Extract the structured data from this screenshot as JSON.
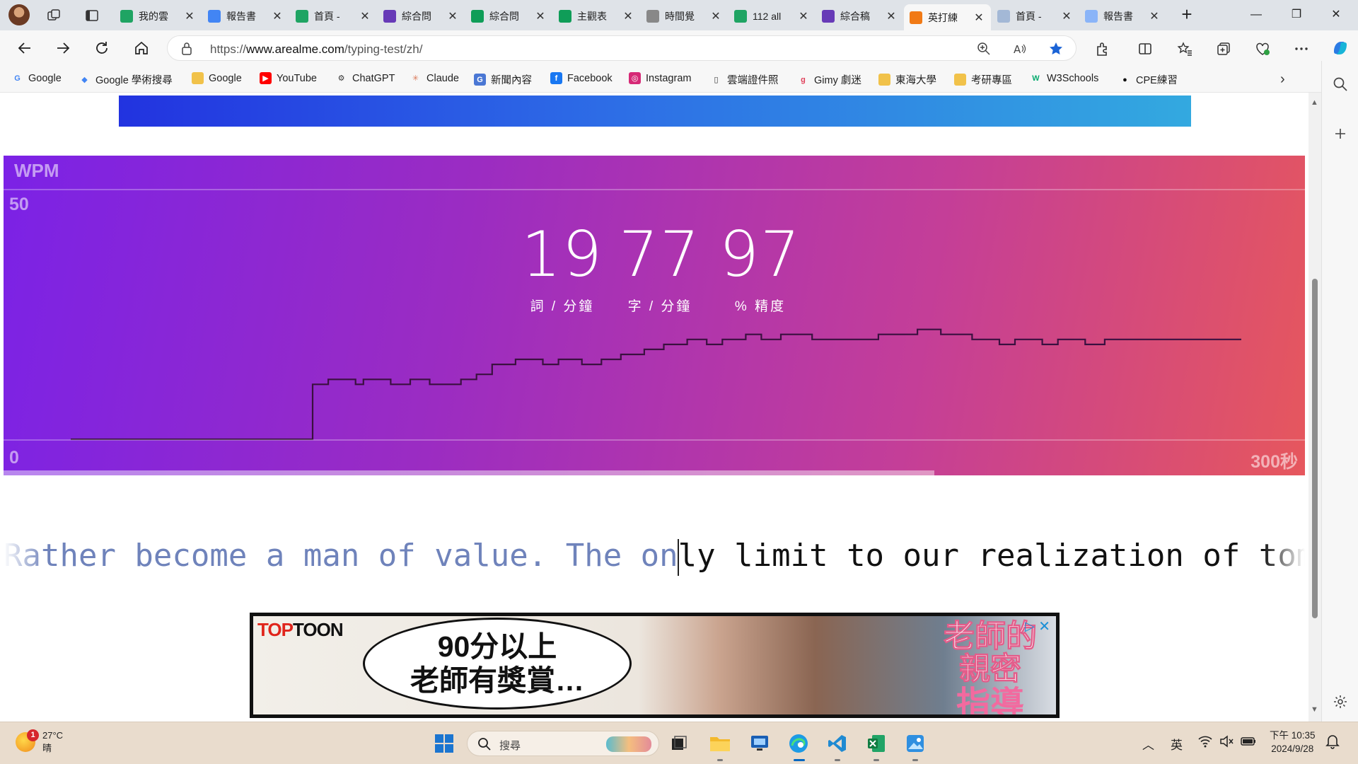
{
  "browser": {
    "tabs": [
      {
        "title": "我的雲",
        "icon": "google-drive-icon",
        "color": "#1fa463"
      },
      {
        "title": "報告書",
        "icon": "google-docs-icon",
        "color": "#4285f4"
      },
      {
        "title": "首頁 - ",
        "icon": "google-drive-icon",
        "color": "#1fa463"
      },
      {
        "title": "綜合問",
        "icon": "google-forms-icon",
        "color": "#673ab7"
      },
      {
        "title": "綜合問",
        "icon": "google-sheets-icon",
        "color": "#0f9d58"
      },
      {
        "title": "主觀表",
        "icon": "google-sheets-icon",
        "color": "#0f9d58"
      },
      {
        "title": "時間覺",
        "icon": "chatgpt-icon",
        "color": "#888888"
      },
      {
        "title": "112 all",
        "icon": "google-slides-icon",
        "color": "#1fa463"
      },
      {
        "title": "綜合稿",
        "icon": "google-forms-icon",
        "color": "#673ab7"
      },
      {
        "title": "英打練",
        "icon": "fox-icon",
        "color": "#f17a16"
      },
      {
        "title": "首頁 - ",
        "icon": "google-drive-icon",
        "color": "#a3b8d6"
      },
      {
        "title": "報告書",
        "icon": "google-docs-icon",
        "color": "#8ab4f8"
      }
    ],
    "active_tab_index": 9,
    "url_prefix": "https://",
    "url_domain": "www.arealme.com",
    "url_path": "/typing-test/zh/",
    "bookmarks": [
      {
        "label": "Google",
        "icon": "google-icon"
      },
      {
        "label": "Google 學術搜尋",
        "icon": "scholar-icon"
      },
      {
        "label": "Google",
        "icon": "folder-icon"
      },
      {
        "label": "YouTube",
        "icon": "youtube-icon"
      },
      {
        "label": "ChatGPT",
        "icon": "chatgpt-icon"
      },
      {
        "label": "Claude",
        "icon": "claude-icon"
      },
      {
        "label": "新聞內容",
        "icon": "news-icon"
      },
      {
        "label": "Facebook",
        "icon": "facebook-icon"
      },
      {
        "label": "Instagram",
        "icon": "instagram-icon"
      },
      {
        "label": "雲端證件照",
        "icon": "page-icon"
      },
      {
        "label": "Gimy 劇迷",
        "icon": "gimy-icon"
      },
      {
        "label": "東海大學",
        "icon": "folder-icon"
      },
      {
        "label": "考研專區",
        "icon": "folder-icon"
      },
      {
        "label": "W3Schools",
        "icon": "w3schools-icon"
      },
      {
        "label": "CPE練習",
        "icon": "github-icon"
      }
    ]
  },
  "result": {
    "wpm_label": "WPM",
    "y_max_label": "50",
    "y_min_label": "0",
    "x_end_label": "300秒",
    "wpm": "19",
    "wpm_unit": "詞 / 分鐘",
    "cpm": "77",
    "cpm_unit": "字 / 分鐘",
    "accuracy": "97",
    "accuracy_unit": "% 精度",
    "progress_fraction": 0.715
  },
  "chart_data": {
    "type": "line",
    "title": "",
    "xlabel": "",
    "ylabel": "WPM",
    "x_range": [
      0,
      300
    ],
    "ylim": [
      0,
      50
    ],
    "x_end_label": "300秒",
    "series": [
      {
        "points": [
          [
            0,
            0
          ],
          [
            20,
            0
          ],
          [
            40,
            0
          ],
          [
            61,
            0
          ],
          [
            62,
            11
          ],
          [
            64,
            11
          ],
          [
            66,
            12
          ],
          [
            71,
            12
          ],
          [
            73,
            11
          ],
          [
            75,
            12
          ],
          [
            76,
            12
          ],
          [
            80,
            12
          ],
          [
            82,
            11
          ],
          [
            85,
            11
          ],
          [
            87,
            12
          ],
          [
            90,
            12
          ],
          [
            92,
            11
          ],
          [
            98,
            11
          ],
          [
            100,
            12
          ],
          [
            102,
            12
          ],
          [
            104,
            13
          ],
          [
            106,
            13
          ],
          [
            108,
            15
          ],
          [
            112,
            15
          ],
          [
            114,
            16
          ],
          [
            119,
            16
          ],
          [
            121,
            15
          ],
          [
            123,
            15
          ],
          [
            125,
            16
          ],
          [
            129,
            16
          ],
          [
            131,
            15
          ],
          [
            134,
            15
          ],
          [
            136,
            16
          ],
          [
            139,
            16
          ],
          [
            141,
            17
          ],
          [
            145,
            17
          ],
          [
            147,
            18
          ],
          [
            150,
            18
          ],
          [
            152,
            19
          ],
          [
            156,
            19
          ],
          [
            158,
            20
          ],
          [
            161,
            20
          ],
          [
            163,
            19
          ],
          [
            165,
            19
          ],
          [
            167,
            20
          ],
          [
            171,
            20
          ],
          [
            173,
            21
          ],
          [
            175,
            21
          ],
          [
            177,
            20
          ],
          [
            180,
            20
          ],
          [
            182,
            21
          ],
          [
            188,
            21
          ],
          [
            190,
            20
          ],
          [
            205,
            20
          ],
          [
            207,
            21
          ],
          [
            215,
            21
          ],
          [
            217,
            22
          ],
          [
            221,
            22
          ],
          [
            223,
            21
          ],
          [
            229,
            21
          ],
          [
            231,
            20
          ],
          [
            236,
            20
          ],
          [
            238,
            19
          ],
          [
            240,
            19
          ],
          [
            242,
            20
          ],
          [
            247,
            20
          ],
          [
            249,
            19
          ],
          [
            251,
            19
          ],
          [
            253,
            20
          ],
          [
            258,
            20
          ],
          [
            260,
            19
          ],
          [
            263,
            19
          ],
          [
            265,
            20
          ],
          [
            300,
            20
          ]
        ]
      }
    ],
    "grid": true
  },
  "typing": {
    "typed": "Rather become a man of value. The on",
    "remaining": "ly limit to our realization of tomo"
  },
  "ad": {
    "brand_red": "TOP",
    "brand_black": "TOON",
    "bubble_line1": "90分以上",
    "bubble_line2": "老師有獎賞…",
    "title_line1": "老師的親密",
    "title_line2": "指導",
    "adchoices": "▷",
    "close": "✕"
  },
  "taskbar": {
    "notification_count": "1",
    "temperature": "27°C",
    "weather": "晴",
    "search_placeholder": "搜尋",
    "ime": "英",
    "time": "下午 10:35",
    "date": "2024/9/28"
  }
}
